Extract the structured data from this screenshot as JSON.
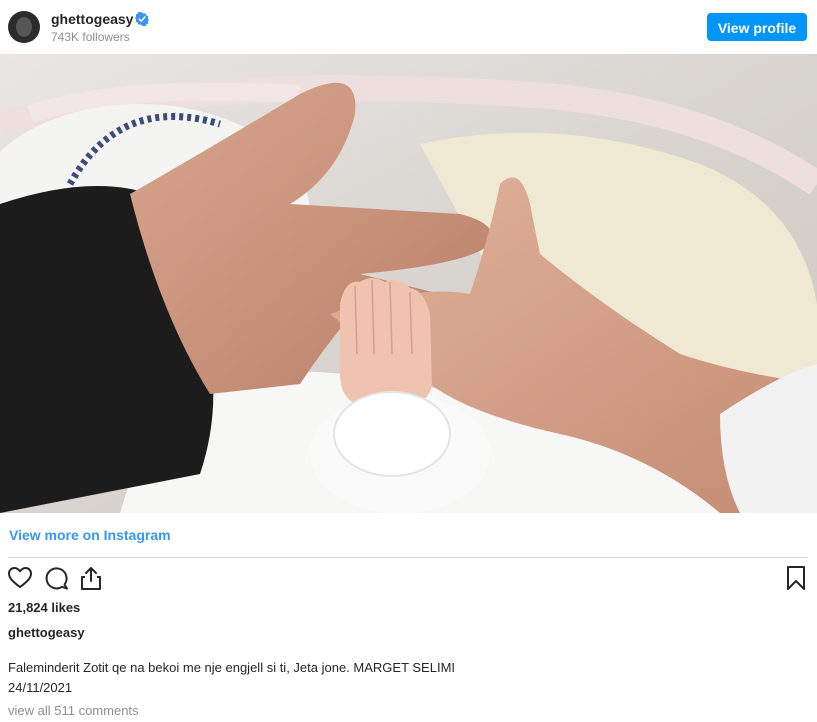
{
  "header": {
    "username": "ghettogeasy",
    "followers": "743K followers",
    "view_profile_label": "View profile"
  },
  "links": {
    "view_more": "View more on Instagram"
  },
  "actions": {
    "like_icon": "heart-icon",
    "comment_icon": "comment-icon",
    "share_icon": "share-icon",
    "save_icon": "bookmark-icon"
  },
  "post": {
    "likes": "21,824 likes",
    "owner": "ghettogeasy",
    "caption": "Faleminderit Zotit qe na bekoi me nje engjell si ti, Jeta jone. MARGET SELIMI",
    "date": "24/11/2021",
    "comments_link": "view all 511 comments"
  },
  "colors": {
    "accent": "#0095f6",
    "link": "#3897f0",
    "verified": "#3897f0",
    "muted": "#8e8e8e"
  }
}
